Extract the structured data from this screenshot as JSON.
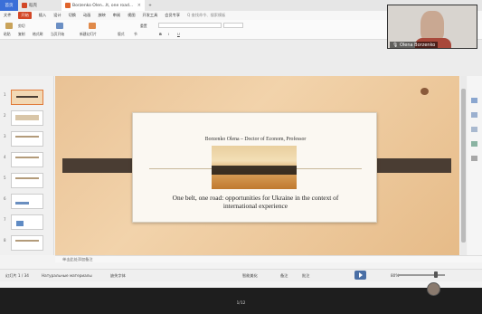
{
  "tabs": {
    "home": "首页",
    "wps": "稻壳",
    "doc": "Borzenko Olen...lt, one road...",
    "close": "×",
    "add": "+"
  },
  "menu": [
    "文件",
    "开始",
    "插入",
    "设计",
    "切换",
    "动画",
    "放映",
    "审阅",
    "视图",
    "开发工具",
    "会员专享",
    "Q 查找命令、搜索模板"
  ],
  "menu_start": "开始",
  "ribbon": {
    "paste": "粘贴",
    "cut": "剪切",
    "copy": "复制",
    "format": "格式刷",
    "from_current": "当页开始",
    "new_slide": "新建幻灯片",
    "layout": "版式",
    "section": "节",
    "reset": "重置",
    "bold": "B",
    "italic": "I",
    "underline": "U",
    "textbox": "文本框",
    "shape": "形状",
    "sort": "排列",
    "find": "查找"
  },
  "slide": {
    "author": "Borzenko Olena – Doctor of Econom, Professor",
    "title_line1": "One belt, one road: opportunities for Ukraine in the context of",
    "title_line2": "international experience"
  },
  "thumbnails": [
    "1",
    "2",
    "3",
    "4",
    "5",
    "6",
    "7",
    "8",
    "9"
  ],
  "notes_placeholder": "单击此处添加备注",
  "status": {
    "slide_count": "幻灯片 1 / 34",
    "language": "Натуральные материалы",
    "font_missing": "缺失字体",
    "smart_beautify": "智能美化",
    "notes": "备注",
    "comments": "批注",
    "zoom": "80%"
  },
  "page_indicator": "1/12",
  "video": {
    "name": "Olena Borzenko"
  },
  "colors": {
    "accent": "#d24726",
    "band": "#4a3d33",
    "home_tab": "#3b6fd8"
  }
}
